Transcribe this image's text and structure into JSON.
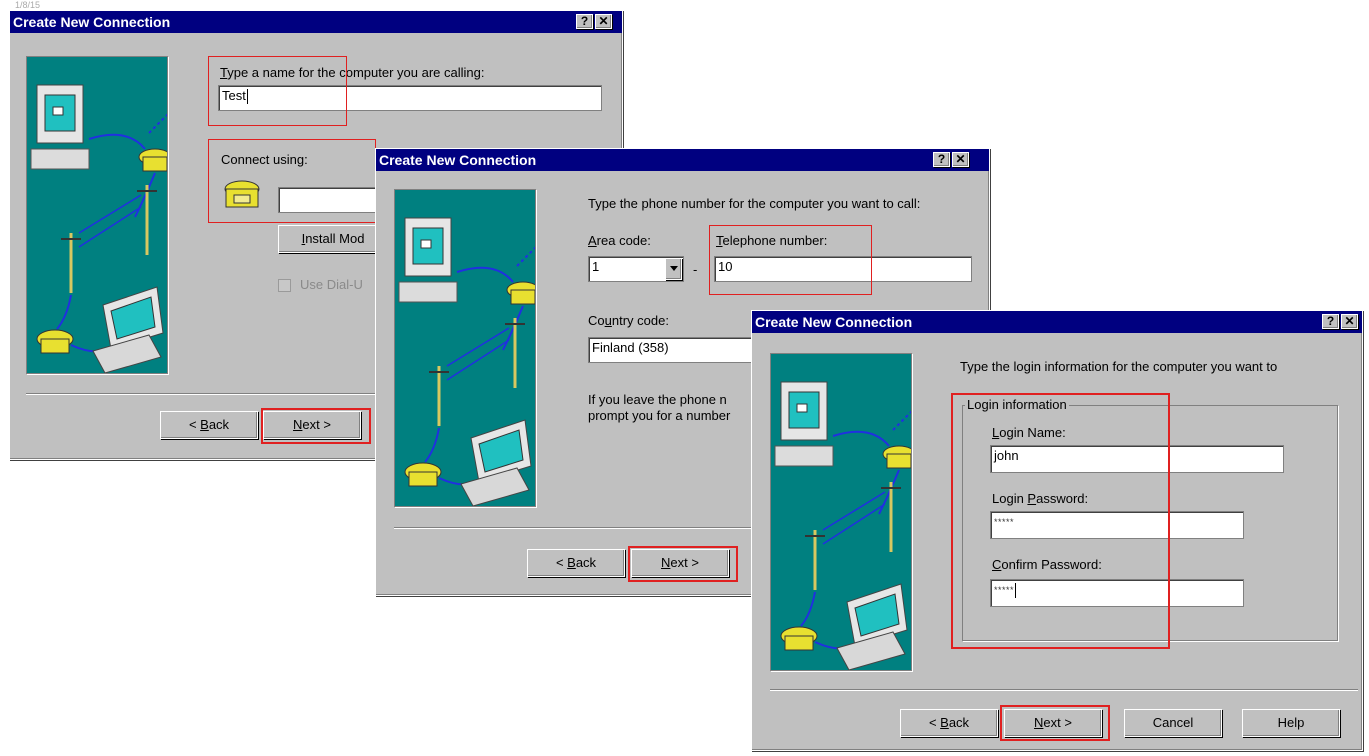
{
  "screen_fragment": "1/8/15",
  "help_glyph": "?",
  "close_glyph": "✕",
  "dialog1": {
    "title": "Create New Connection",
    "name_label_u": "T",
    "name_label_rest": "ype a name for the computer you are calling:",
    "name_value": "Test",
    "connect_label": "Connect using:",
    "connect_value": "",
    "install_u": "I",
    "install_rest": "nstall Mod",
    "dialup_label": "Use Dial-U",
    "back_prefix": "< ",
    "back_u": "B",
    "back_rest": "ack",
    "next_u": "N",
    "next_rest": "ext >"
  },
  "dialog2": {
    "title": "Create New Connection",
    "instruction": "Type the phone number for the computer you want to call:",
    "area_u": "A",
    "area_rest": "rea code:",
    "area_value": "1",
    "dash": "-",
    "tel_u": "T",
    "tel_rest": "elephone number:",
    "tel_value": "10",
    "country_pre": "Co",
    "country_u": "u",
    "country_rest": "ntry code:",
    "country_value": "Finland (358)",
    "note_line1": "If you leave the phone n",
    "note_line2": "prompt you for a number",
    "back_prefix": "< ",
    "back_u": "B",
    "back_rest": "ack",
    "next_u": "N",
    "next_rest": "ext >"
  },
  "dialog3": {
    "title": "Create New Connection",
    "instruction": "Type the login information for the computer you want to",
    "group_title": "Login information",
    "login_u": "L",
    "login_rest": "ogin Name:",
    "login_value": "john",
    "pw_pre": "Login ",
    "pw_u": "P",
    "pw_rest": "assword:",
    "pw_value": "*****",
    "confirm_u": "C",
    "confirm_rest": "onfirm Password:",
    "confirm_value": "*****",
    "back_prefix": "< ",
    "back_u": "B",
    "back_rest": "ack",
    "next_u": "N",
    "next_rest": "ext >",
    "cancel_label": "Cancel",
    "help_label": "Help"
  },
  "colors": {
    "title_bar": "#000080",
    "dialog_face": "#c0c0c0",
    "artwork_bg": "#008080",
    "highlight_box": "#e02020"
  },
  "icons": [
    "computer-monitor-icon",
    "telephone-icon",
    "utility-pole-icon",
    "laptop-icon",
    "help-icon",
    "close-icon",
    "dropdown-arrow-icon",
    "modem-phone-icon",
    "checkbox-icon"
  ]
}
